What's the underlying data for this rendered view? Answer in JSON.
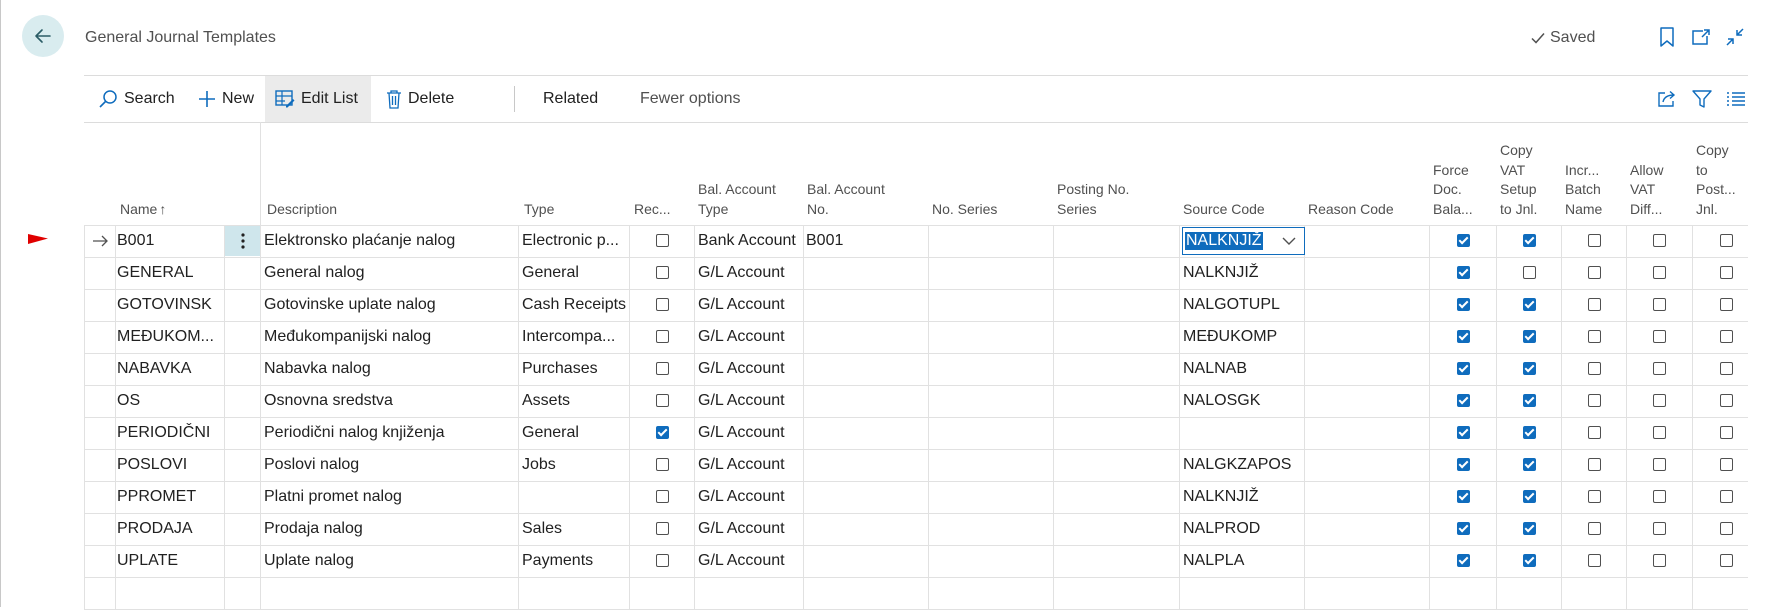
{
  "header": {
    "title": "General Journal Templates",
    "saved_label": "Saved",
    "icons": [
      "back-arrow-icon",
      "check-icon",
      "bookmark-icon",
      "open-new-window-icon",
      "collapse-icon"
    ]
  },
  "toolbar": {
    "search_label": "Search",
    "new_label": "New",
    "edit_list_label": "Edit List",
    "delete_label": "Delete",
    "related_label": "Related",
    "fewer_options_label": "Fewer options",
    "right_icons": [
      "share-icon",
      "filter-icon",
      "list-view-icon"
    ]
  },
  "columns": {
    "name": "Name",
    "name_sort": "↑",
    "description": "Description",
    "type": "Type",
    "recurring": "Rec...",
    "bal_type_1": "Bal. Account",
    "bal_type_2": "Type",
    "bal_no_1": "Bal. Account",
    "bal_no_2": "No.",
    "no_series": "No. Series",
    "posting_1": "Posting No.",
    "posting_2": "Series",
    "source_code": "Source Code",
    "reason_code": "Reason Code",
    "force_1": "Force",
    "force_2": "Doc.",
    "force_3": "Bala...",
    "copy_vat_1": "Copy",
    "copy_vat_2": "VAT",
    "copy_vat_3": "Setup",
    "copy_vat_4": "to Jnl.",
    "incr_1": "Incr...",
    "incr_2": "Batch",
    "incr_3": "Name",
    "allow_1": "Allow",
    "allow_2": "VAT",
    "allow_3": "Diff...",
    "copy_post_1": "Copy",
    "copy_post_2": "to",
    "copy_post_3": "Post...",
    "copy_post_4": "Jnl."
  },
  "rows": [
    {
      "name": "B001",
      "description": "Elektronsko plaćanje nalog",
      "type": "Electronic p...",
      "recurring": false,
      "bal_type": "Bank Account",
      "bal_no": "B001",
      "no_series": "",
      "posting_series": "",
      "source_code": "NALKNJIŽ",
      "reason_code": "",
      "force": true,
      "copy_vat": true,
      "incr": false,
      "allow": false,
      "copy_post": false
    },
    {
      "name": "GENERAL",
      "description": "General nalog",
      "type": "General",
      "recurring": false,
      "bal_type": "G/L Account",
      "bal_no": "",
      "no_series": "",
      "posting_series": "",
      "source_code": "NALKNJIŽ",
      "reason_code": "",
      "force": true,
      "copy_vat": false,
      "incr": false,
      "allow": false,
      "copy_post": false
    },
    {
      "name": "GOTOVINSK",
      "description": "Gotovinske uplate nalog",
      "type": "Cash Receipts",
      "recurring": false,
      "bal_type": "G/L Account",
      "bal_no": "",
      "no_series": "",
      "posting_series": "",
      "source_code": "NALGOTUPL",
      "reason_code": "",
      "force": true,
      "copy_vat": true,
      "incr": false,
      "allow": false,
      "copy_post": false
    },
    {
      "name": "MEĐUKOM...",
      "description": "Međukompanijski nalog",
      "type": "Intercompa...",
      "recurring": false,
      "bal_type": "G/L Account",
      "bal_no": "",
      "no_series": "",
      "posting_series": "",
      "source_code": "MEĐUKOMP",
      "reason_code": "",
      "force": true,
      "copy_vat": true,
      "incr": false,
      "allow": false,
      "copy_post": false
    },
    {
      "name": "NABAVKA",
      "description": "Nabavka nalog",
      "type": "Purchases",
      "recurring": false,
      "bal_type": "G/L Account",
      "bal_no": "",
      "no_series": "",
      "posting_series": "",
      "source_code": "NALNAB",
      "reason_code": "",
      "force": true,
      "copy_vat": true,
      "incr": false,
      "allow": false,
      "copy_post": false
    },
    {
      "name": "OS",
      "description": "Osnovna sredstva",
      "type": "Assets",
      "recurring": false,
      "bal_type": "G/L Account",
      "bal_no": "",
      "no_series": "",
      "posting_series": "",
      "source_code": "NALOSGK",
      "reason_code": "",
      "force": true,
      "copy_vat": true,
      "incr": false,
      "allow": false,
      "copy_post": false
    },
    {
      "name": "PERIODIČNI",
      "description": "Periodični nalog knjiženja",
      "type": "General",
      "recurring": true,
      "bal_type": "G/L Account",
      "bal_no": "",
      "no_series": "",
      "posting_series": "",
      "source_code": "",
      "reason_code": "",
      "force": true,
      "copy_vat": true,
      "incr": false,
      "allow": false,
      "copy_post": false
    },
    {
      "name": "POSLOVI",
      "description": "Poslovi nalog",
      "type": "Jobs",
      "recurring": false,
      "bal_type": "G/L Account",
      "bal_no": "",
      "no_series": "",
      "posting_series": "",
      "source_code": "NALGKZAPOS",
      "reason_code": "",
      "force": true,
      "copy_vat": true,
      "incr": false,
      "allow": false,
      "copy_post": false
    },
    {
      "name": "PPROMET",
      "description": "Platni promet nalog",
      "type": "",
      "recurring": false,
      "bal_type": "G/L Account",
      "bal_no": "",
      "no_series": "",
      "posting_series": "",
      "source_code": "NALKNJIŽ",
      "reason_code": "",
      "force": true,
      "copy_vat": true,
      "incr": false,
      "allow": false,
      "copy_post": false
    },
    {
      "name": "PRODAJA",
      "description": "Prodaja nalog",
      "type": "Sales",
      "recurring": false,
      "bal_type": "G/L Account",
      "bal_no": "",
      "no_series": "",
      "posting_series": "",
      "source_code": "NALPROD",
      "reason_code": "",
      "force": true,
      "copy_vat": true,
      "incr": false,
      "allow": false,
      "copy_post": false
    },
    {
      "name": "UPLATE",
      "description": "Uplate nalog",
      "type": "Payments",
      "recurring": false,
      "bal_type": "G/L Account",
      "bal_no": "",
      "no_series": "",
      "posting_series": "",
      "source_code": "NALPLA",
      "reason_code": "",
      "force": true,
      "copy_vat": true,
      "incr": false,
      "allow": false,
      "copy_post": false
    }
  ],
  "selected_row": 0,
  "accent_color": "#0f6cbd",
  "row_marker_color": "#e00000"
}
